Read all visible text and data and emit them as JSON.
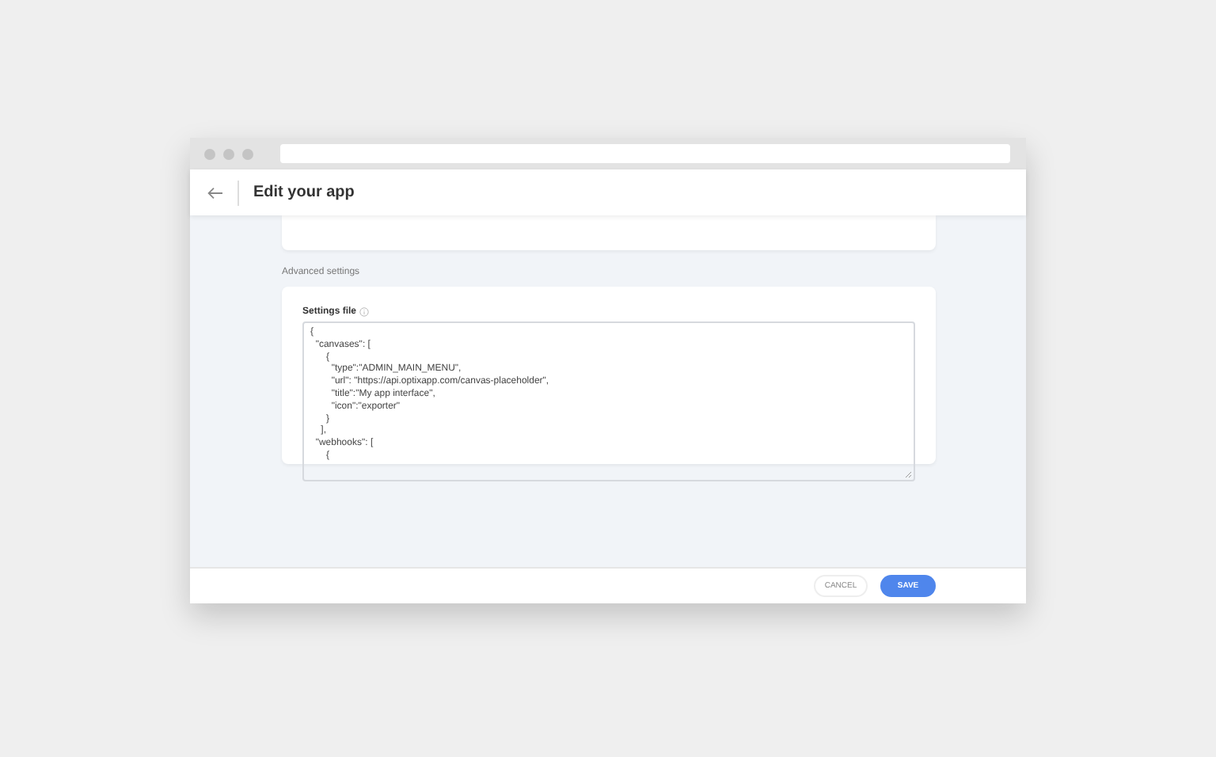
{
  "browser": {
    "title": "Edit your app"
  },
  "section": {
    "heading": "Advanced settings"
  },
  "settings_file": {
    "label": "Settings file",
    "lines": [
      "{",
      "  \"canvases\": [",
      "      {",
      "        \"type\":\"ADMIN_MAIN_MENU\",",
      "        \"url\": \"https://api.optixapp.com/canvas-placeholder\",",
      "        \"title\":\"My app interface\",",
      "        \"icon\":\"exporter\"",
      "      }",
      "    ],",
      "  \"webhooks\": [",
      "      {"
    ]
  },
  "buttons": [
    {
      "label": "CANCEL",
      "kind": "secondary"
    },
    {
      "label": "SAVE",
      "kind": "primary"
    }
  ]
}
